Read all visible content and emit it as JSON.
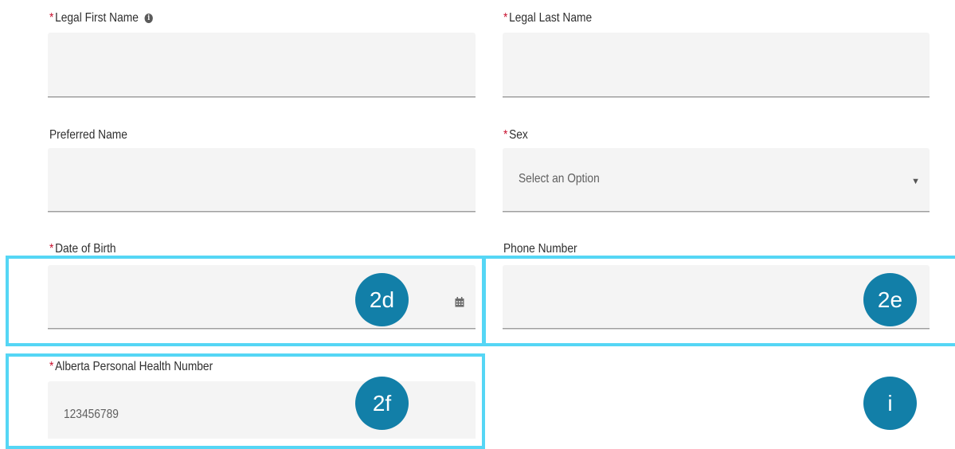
{
  "form": {
    "legal_first_name": {
      "label": "Legal First Name",
      "required_mark": "*",
      "info_icon": "i"
    },
    "legal_last_name": {
      "label": "Legal Last Name",
      "required_mark": "*"
    },
    "preferred_name": {
      "label": "Preferred Name"
    },
    "sex": {
      "label": "Sex",
      "required_mark": "*",
      "selected": "Select an Option",
      "caret": "▼"
    },
    "date_of_birth": {
      "label": "Date of Birth",
      "required_mark": "*",
      "calendar_icon": "calendar-icon"
    },
    "phone_number": {
      "label": "Phone Number"
    },
    "health_number": {
      "label": "Alberta Personal Health Number",
      "required_mark": "*",
      "value": "123456789"
    }
  },
  "annotations": {
    "badge_2d": "2d",
    "badge_2e": "2e",
    "badge_2f": "2f",
    "badge_i": "i",
    "highlight_color": "#55d6f5",
    "badge_color": "#127fa8"
  }
}
